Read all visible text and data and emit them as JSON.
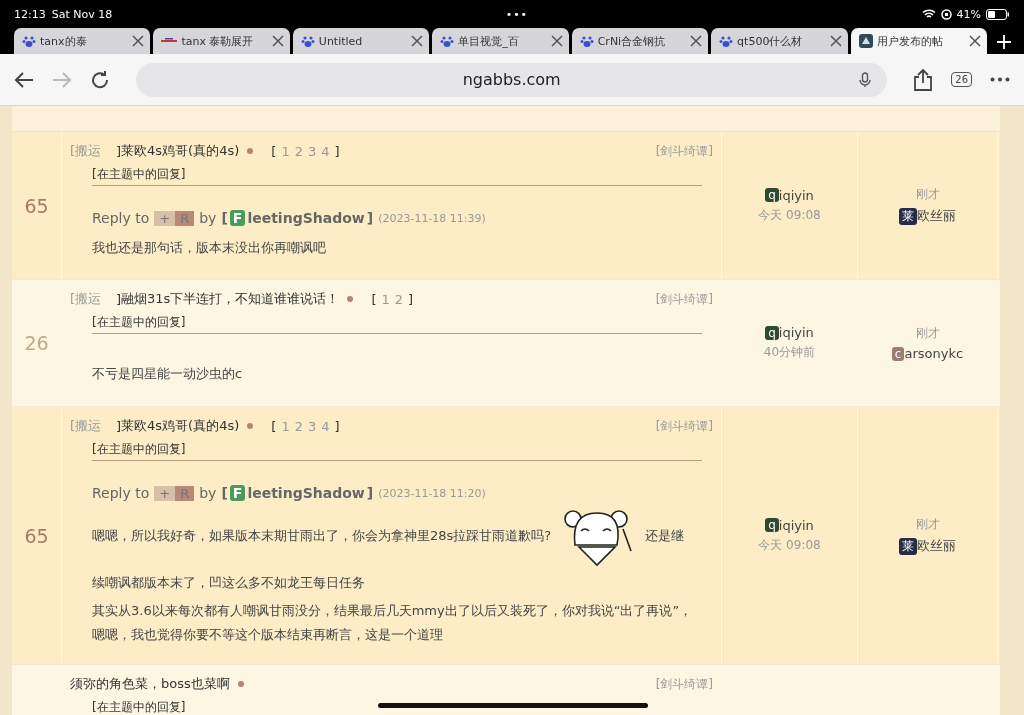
{
  "status_bar": {
    "time": "12:13",
    "date": "Sat Nov 18",
    "dots": "•••",
    "battery": "41%"
  },
  "tabs": [
    {
      "title": "tanx的泰",
      "kind": "paw",
      "selected": false
    },
    {
      "title": "tanx 泰勒展开",
      "kind": "logo",
      "selected": false
    },
    {
      "title": "Untitled",
      "kind": "paw",
      "selected": false
    },
    {
      "title": "单目视觉_百",
      "kind": "paw",
      "selected": false
    },
    {
      "title": "CrNi合金钢抗",
      "kind": "paw",
      "selected": false
    },
    {
      "title": "qt500什么材",
      "kind": "paw",
      "selected": false
    },
    {
      "title": "用户发布的帖",
      "kind": "site",
      "selected": true
    }
  ],
  "toolbar": {
    "url": "ngabbs.com",
    "tab_count": "26",
    "forward_disabled": true
  },
  "rows": [
    {
      "count": {
        "text": "65",
        "color": "#a87a68"
      },
      "tag": "[搬运",
      "tag_close": "]",
      "title": "莱欧4s鸡哥(真的4s)",
      "pages_open": "[",
      "pages": [
        "1",
        "2",
        "3",
        "4"
      ],
      "pages_close": "]",
      "forum": "[剑斗绮谭]",
      "sub": "[在主题中的回复]",
      "reply": {
        "prefix": "Reply to",
        "badges": [
          "+",
          "R"
        ],
        "by": "by",
        "open": "[",
        "avatar": "F",
        "name": "leetingShadow",
        "close": "]",
        "time": "(2023-11-18 11:39)"
      },
      "body": [
        [
          {
            "kind": "text",
            "text": "我也还是那句话，版本末没出你再嘲讽吧"
          }
        ]
      ],
      "author": {
        "avatar": {
          "letter": "q",
          "color": "#2f4a2f"
        },
        "name": "iqiyin",
        "time": "今天 09:08"
      },
      "last": {
        "time": "刚才",
        "avatar": {
          "letter": "莱",
          "color": "#262c44"
        },
        "name": "欧丝丽"
      }
    },
    {
      "count": {
        "text": "26",
        "color": "#c4a684"
      },
      "tag": "[搬运",
      "tag_close": "]",
      "title": "融烟31s下半连打，不知道谁谁说话！",
      "pages_open": "[",
      "pages": [
        "1",
        "2"
      ],
      "pages_close": "]",
      "forum": "[剑斗绮谭]",
      "sub": "[在主题中的回复]",
      "body": [
        [
          {
            "kind": "text",
            "text": "不亏是四星能一动沙虫的c"
          }
        ]
      ],
      "author": {
        "avatar": {
          "letter": "q",
          "color": "#2f4a2f"
        },
        "name": "iqiyin",
        "time": "40分钟前"
      },
      "last": {
        "time": "刚才",
        "avatar": {
          "letter": "c",
          "color": "#9a7d74"
        },
        "name": "arsonykc"
      }
    },
    {
      "count": {
        "text": "65",
        "color": "#a87a68"
      },
      "tag": "[搬运",
      "tag_close": "]",
      "title": "莱欧4s鸡哥(真的4s)",
      "pages_open": "[",
      "pages": [
        "1",
        "2",
        "3",
        "4"
      ],
      "pages_close": "]",
      "forum": "[剑斗绮谭]",
      "sub": "[在主题中的回复]",
      "reply": {
        "prefix": "Reply to",
        "badges": [
          "+",
          "R"
        ],
        "by": "by",
        "open": "[",
        "avatar": "F",
        "name": "leetingShadow",
        "close": "]",
        "time": "(2023-11-18 11:20)"
      },
      "body": [
        [
          {
            "kind": "text",
            "text": "嗯嗯，所以我好奇，如果版本末期甘雨出了，你会为拿神里28s拉踩甘雨道歉吗?"
          },
          {
            "kind": "sticker"
          },
          {
            "kind": "text",
            "text": "还是继"
          }
        ],
        [
          {
            "kind": "text",
            "text": "续嘲讽都版本末了，凹这么多不如龙王每日任务"
          }
        ],
        [
          {
            "kind": "text",
            "text": "其实从3.6以来每次都有人嘲讽甘雨没分，结果最后几天mmy出了以后又装死了，你对我说“出了再说”，嗯嗯，我也觉得你要不等这个版本结束再断言，这是一个道理"
          }
        ]
      ],
      "author": {
        "avatar": {
          "letter": "q",
          "color": "#2f4a2f"
        },
        "name": "iqiyin",
        "time": "今天 09:08"
      },
      "last": {
        "time": "刚才",
        "avatar": {
          "letter": "莱",
          "color": "#262c44"
        },
        "name": "欧丝丽"
      }
    },
    {
      "title": "须弥的角色菜，boss也菜啊",
      "forum": "[剑斗绮谭]",
      "sub": "[在主题中的回复]"
    }
  ]
}
